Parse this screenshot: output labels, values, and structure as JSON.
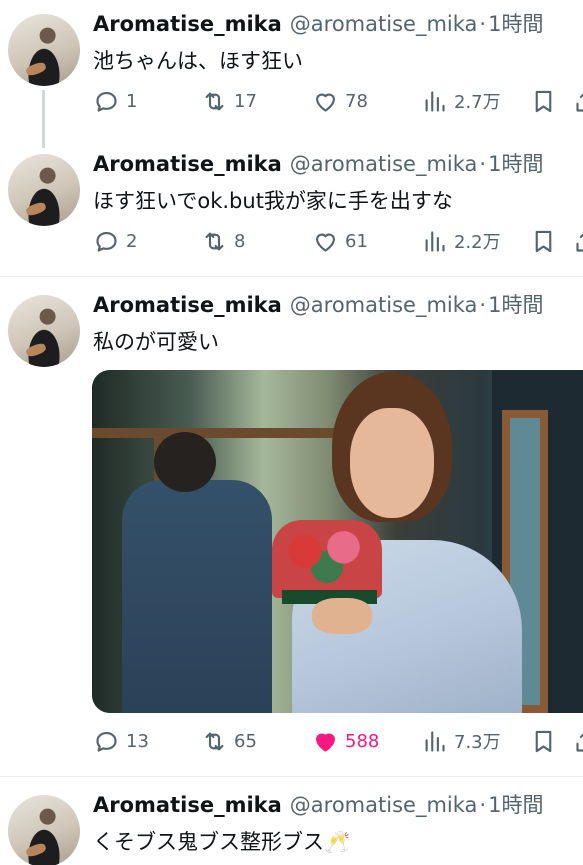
{
  "tweets": [
    {
      "name": "Aromatise_mika",
      "handle": "@aromatise_mika",
      "separator": "·",
      "time": "1時間",
      "text": "池ちゃんは、ほす狂い",
      "replies": "1",
      "retweets": "17",
      "likes": "78",
      "views": "2.7万",
      "liked": false
    },
    {
      "name": "Aromatise_mika",
      "handle": "@aromatise_mika",
      "separator": "·",
      "time": "1時間",
      "text": "ほす狂いでok.but我が家に手を出すな",
      "replies": "2",
      "retweets": "8",
      "likes": "61",
      "views": "2.2万",
      "liked": false
    },
    {
      "name": "Aromatise_mika",
      "handle": "@aromatise_mika",
      "separator": "·",
      "time": "1時間",
      "text": "私のが可愛い",
      "replies": "13",
      "retweets": "65",
      "likes": "588",
      "views": "7.3万",
      "liked": true
    },
    {
      "name": "Aromatise_mika",
      "handle": "@aromatise_mika",
      "separator": "·",
      "time": "1時間",
      "text": "くそブス鬼ブス整形ブス🥂"
    }
  ],
  "colors": {
    "text_primary": "#0f1419",
    "text_secondary": "#536471",
    "like_active": "#f91880",
    "divider": "#e6ecf0"
  },
  "icons": {
    "reply": "speech-bubble-icon",
    "retweet": "retweet-arrows-icon",
    "like": "heart-icon",
    "views": "bar-chart-icon",
    "bookmark": "bookmark-icon",
    "share": "share-icon"
  }
}
